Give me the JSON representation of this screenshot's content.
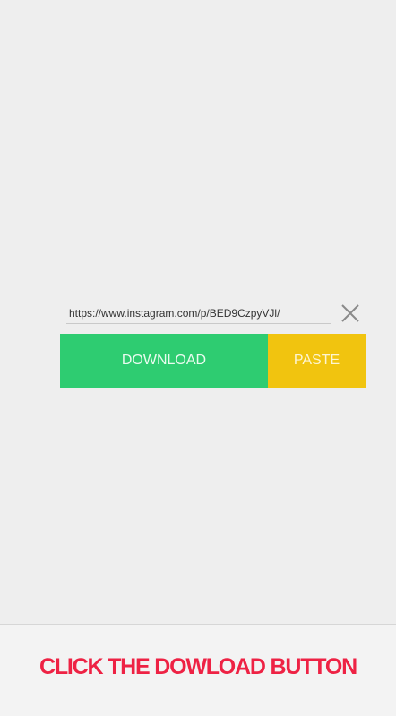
{
  "url_input": {
    "value": "https://www.instagram.com/p/BED9CzpyVJl/"
  },
  "buttons": {
    "download_label": "DOWNLOAD",
    "paste_label": "PASTE"
  },
  "icons": {
    "clear": "close-icon"
  },
  "caption": {
    "text": "CLICK THE DOWLOAD BUTTON"
  },
  "colors": {
    "download": "#2ecc71",
    "paste": "#f1c40f",
    "caption": "#ee2244",
    "background": "#eeeeee"
  }
}
